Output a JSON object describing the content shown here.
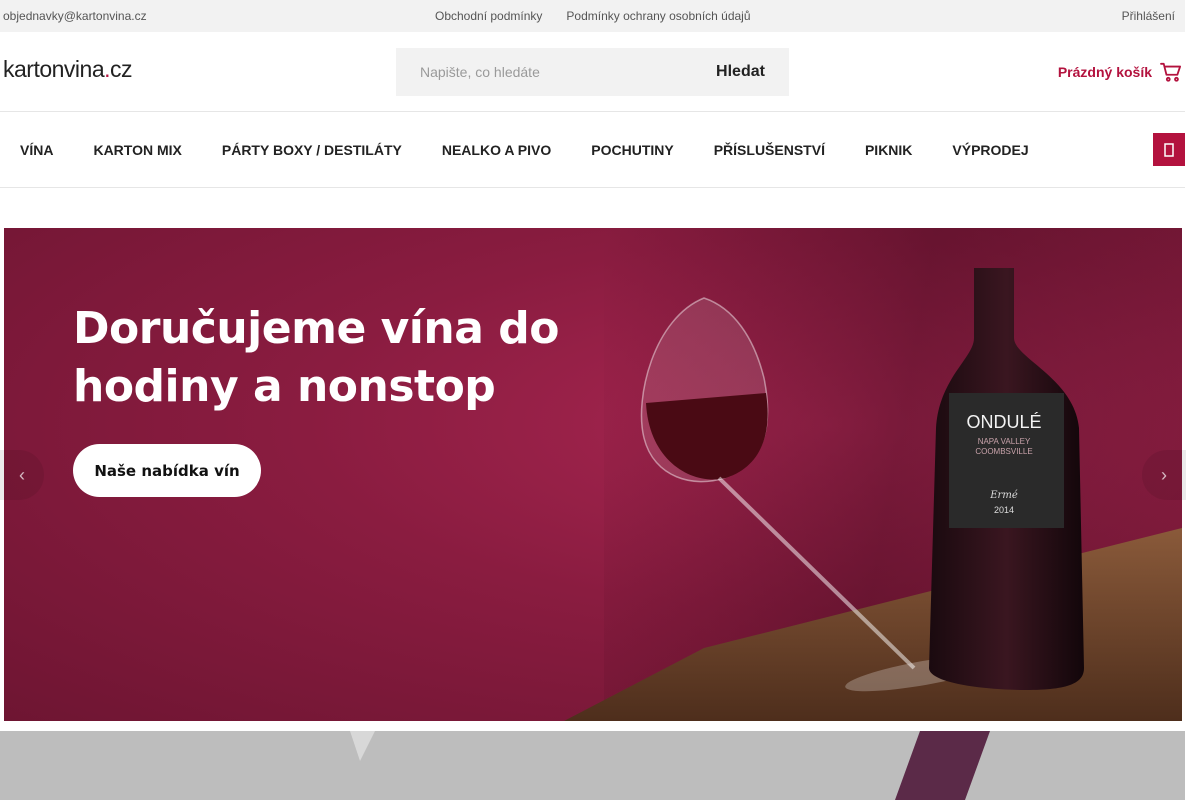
{
  "topbar": {
    "email": "objednavky@kartonvina.cz",
    "links": [
      "Obchodní podmínky",
      "Podmínky ochrany osobních údajů"
    ],
    "login": "Přihlášení"
  },
  "header": {
    "logo_main": "kartonvina",
    "logo_dot": ".",
    "logo_tld": "cz",
    "search_placeholder": "Napište, co hledáte",
    "search_button": "Hledat",
    "cart_label": "Prázdný košík"
  },
  "nav": {
    "items": [
      "VÍNA",
      "KARTON MIX",
      "PÁRTY BOXY / DESTILÁTY",
      "NEALKO A PIVO",
      "POCHUTINY",
      "PŘÍSLUŠENSTVÍ",
      "PIKNIK",
      "VÝPRODEJ"
    ]
  },
  "hero": {
    "headline": "Doručujeme vína do hodiny a nonstop",
    "cta": "Naše nabídka vín",
    "bottle_label": {
      "brand": "ONDULÉ",
      "region_line1": "NAPA VALLEY",
      "region_line2": "COOMBSVILLE",
      "signature": "Ermé",
      "year": "2014"
    }
  },
  "colors": {
    "accent": "#b3123e",
    "hero_bg": "#8a1c40",
    "topbar_bg": "#f2f2f2"
  }
}
